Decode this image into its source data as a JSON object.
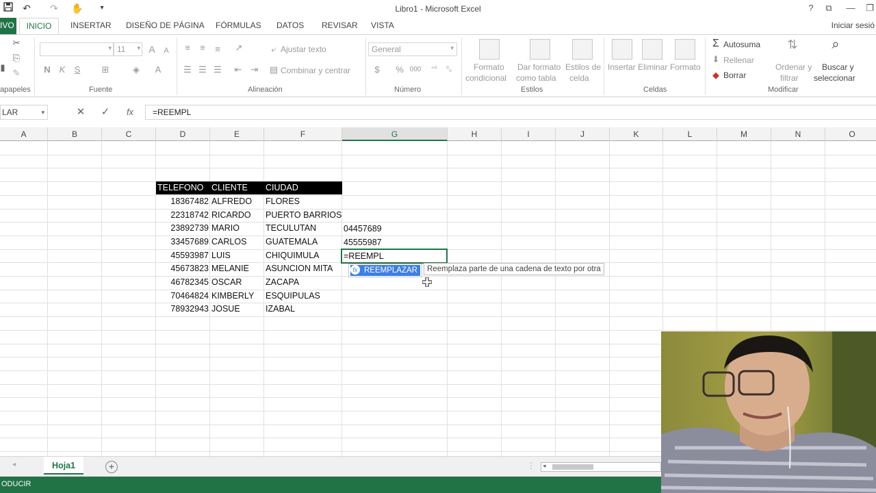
{
  "window": {
    "title": "Libro1 - Microsoft Excel",
    "help": "?"
  },
  "tabs": [
    {
      "label": "IVO"
    },
    {
      "label": "INICIO"
    },
    {
      "label": "INSERTAR"
    },
    {
      "label": "DISEÑO DE PÁGINA"
    },
    {
      "label": "FÓRMULAS"
    },
    {
      "label": "DATOS"
    },
    {
      "label": "REVISAR"
    },
    {
      "label": "VISTA"
    }
  ],
  "signin": "Iniciar sesió",
  "ribbon": {
    "groups": {
      "clipboard": "apapeles",
      "font": "Fuente",
      "alignment": "Alineación",
      "number": "Número",
      "styles": "Estilos",
      "cells": "Celdas",
      "modify": "Modificar"
    },
    "font_size": "11",
    "bold": "N",
    "italic": "K",
    "underline": "S",
    "grow_font": "A",
    "wrap_text": "Ajustar texto",
    "merge_center": "Combinar y centrar",
    "number_format": "General",
    "percent": "%",
    "thousands": "000",
    "conditional_format": [
      "Formato",
      "condicional"
    ],
    "format_table": [
      "Dar formato",
      "como tabla"
    ],
    "cell_styles": [
      "Estilos de",
      "celda"
    ],
    "insert": "Insertar",
    "delete": "Eliminar",
    "format": "Formato",
    "autosum": "Autosuma",
    "fill": "Rellenar",
    "clear": "Borrar",
    "sort_filter": [
      "Ordenar y",
      "filtrar"
    ],
    "find_select": [
      "Buscar y",
      "seleccionar"
    ]
  },
  "formula_bar": {
    "name_box": "LAR",
    "cancel": "✕",
    "enter": "✓",
    "fx": "fx",
    "content": "=REEMPL"
  },
  "columns": [
    "A",
    "B",
    "C",
    "D",
    "E",
    "F",
    "G",
    "H",
    "I",
    "J",
    "K",
    "L",
    "M",
    "N",
    "O"
  ],
  "table": {
    "headers": [
      "TELEFONO",
      "CLIENTE",
      "CIUDAD"
    ],
    "rows": [
      [
        "18367482",
        "ALFREDO",
        "FLORES"
      ],
      [
        "22318742",
        "RICARDO",
        "PUERTO BARRIOS"
      ],
      [
        "23892739",
        "MARIO",
        "TECULUTAN"
      ],
      [
        "33457689",
        "CARLOS",
        "GUATEMALA"
      ],
      [
        "45593987",
        "LUIS",
        "CHIQUIMULA"
      ],
      [
        "45673823",
        "MELANIE",
        "ASUNCION MITA"
      ],
      [
        "46782345",
        "OSCAR",
        "ZACAPA"
      ],
      [
        "70464824",
        "KIMBERLY",
        "ESQUIPULAS"
      ],
      [
        "78932943",
        "JOSUE",
        "IZABAL"
      ]
    ]
  },
  "column_g": {
    "carlos": "04457689",
    "luis": "45555987",
    "editing": "=REEMPL"
  },
  "autocomplete": {
    "item": "REEMPLAZAR",
    "fx": "fx",
    "tooltip": "Reemplaza parte de una cadena de texto por otra"
  },
  "sheet": {
    "name": "Hoja1",
    "add": "+"
  },
  "status": "ODUCIR",
  "accent": "#217346",
  "icons": [
    "save-icon",
    "undo-icon",
    "redo-icon",
    "touch-mode-icon",
    "function-icon",
    "add-sheet-icon"
  ]
}
